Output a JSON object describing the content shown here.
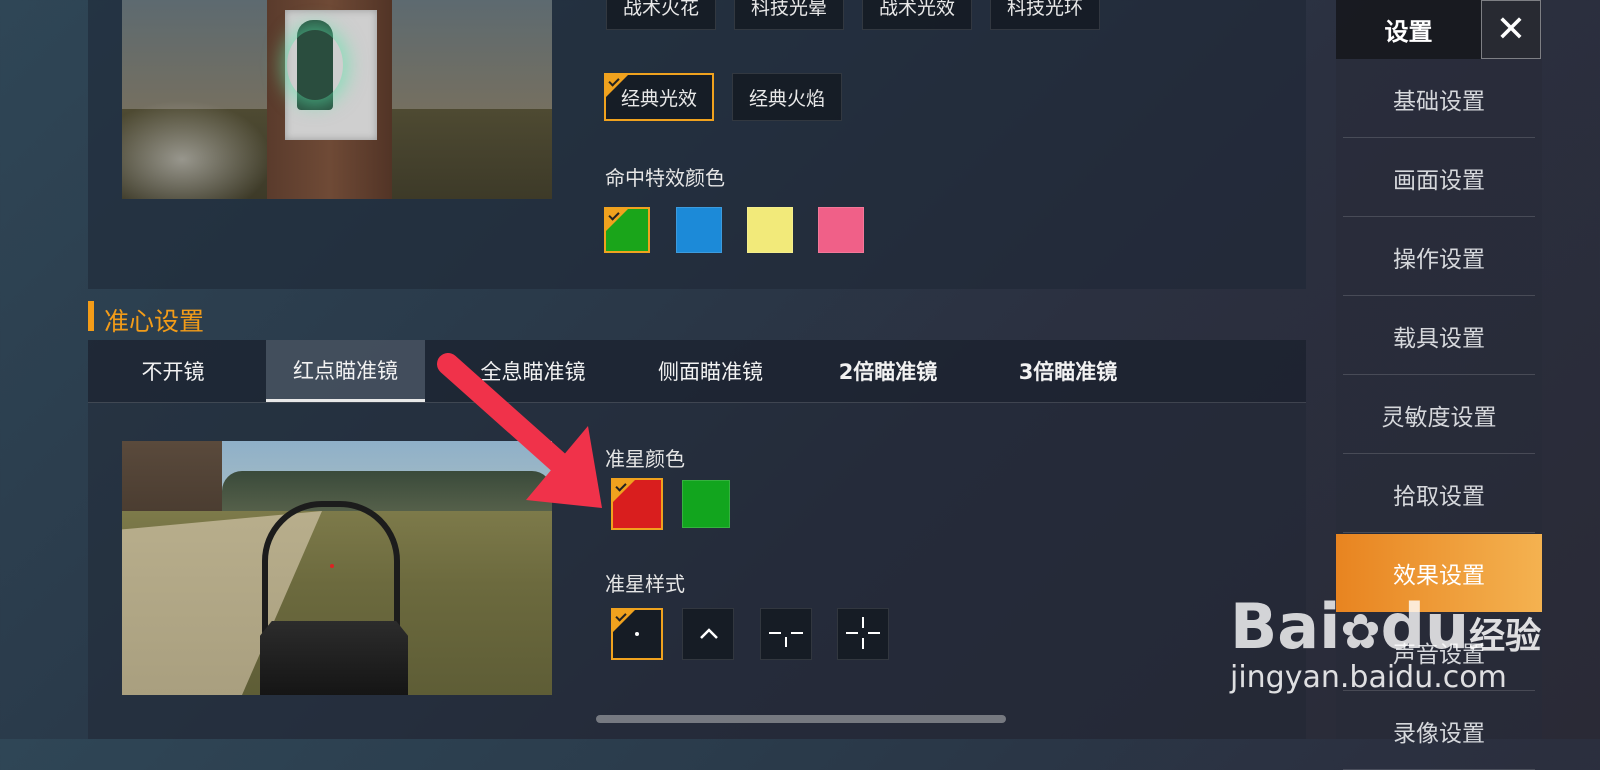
{
  "effects": {
    "top_buttons": [
      "战术火花",
      "科技光晕",
      "战术光效",
      "科技光环"
    ],
    "style_buttons": [
      {
        "label": "经典光效",
        "selected": true
      },
      {
        "label": "经典火焰",
        "selected": false
      }
    ],
    "hit_color_label": "命中特效颜色",
    "hit_colors": [
      "#1aa51a",
      "#1c8ad8",
      "#f2ea7a",
      "#f06088"
    ],
    "hit_color_selected": 0
  },
  "crosshair": {
    "section_title": "准心设置",
    "tabs": [
      "不开镜",
      "红点瞄准镜",
      "全息瞄准镜",
      "侧面瞄准镜",
      "2倍瞄准镜",
      "3倍瞄准镜"
    ],
    "active_tab": 1,
    "color_label": "准星颜色",
    "colors": [
      "#d91e1e",
      "#12a51e"
    ],
    "color_selected": 0,
    "style_label": "准星样式",
    "styles": [
      "dot-icon",
      "chevron-up-icon",
      "dashed-cross-icon",
      "cross-icon"
    ],
    "style_selected": 0
  },
  "sidebar": {
    "title": "设置",
    "close_icon": "close-icon",
    "items": [
      "基础设置",
      "画面设置",
      "操作设置",
      "载具设置",
      "灵敏度设置",
      "拾取设置",
      "效果设置",
      "声音设置",
      "录像设置"
    ],
    "active_index": 6
  },
  "watermark": {
    "brand": "Bai",
    "brand2": "du",
    "suffix": "经验",
    "url": "jingyan.baidu.com"
  },
  "accent_color": "#f39c18",
  "annotation_arrow_color": "#f0324a"
}
